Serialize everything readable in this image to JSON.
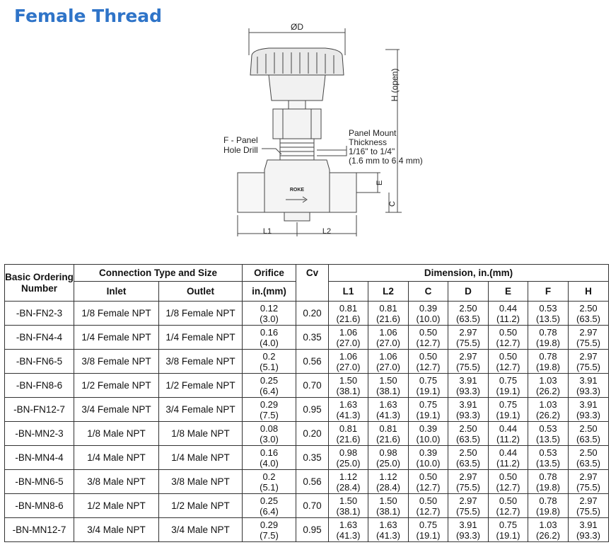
{
  "title": "Female Thread",
  "diagram": {
    "label_od": "ØD",
    "label_h": "H (open)",
    "label_f_line1": "F - Panel",
    "label_f_line2": "Hole Drill",
    "label_panel_1": "Panel Mount",
    "label_panel_2": "Thickness",
    "label_panel_3": "1/16\" to 1/4\"",
    "label_panel_4": "(1.6 mm to 6.4 mm)",
    "label_e": "E",
    "label_c": "C",
    "label_l1": "L1",
    "label_l2": "L2",
    "brand": "ROKE"
  },
  "table": {
    "headers": {
      "basic_ordering": "Basic Ordering Number",
      "connection": "Connection Type and Size",
      "inlet": "Inlet",
      "outlet": "Outlet",
      "orifice_1": "Orifice",
      "orifice_2": "in.(mm)",
      "cv": "Cv",
      "dimension": "Dimension, in.(mm)",
      "l1": "L1",
      "l2": "L2",
      "c": "C",
      "d": "D",
      "e": "E",
      "f": "F",
      "h": "H"
    },
    "rows": [
      {
        "num": "-BN-FN2-3",
        "inlet": "1/8 Female NPT",
        "outlet": "1/8 Female NPT",
        "orifice": "0.12",
        "orifice_mm": "(3.0)",
        "cv": "0.20",
        "l1": "0.81",
        "l1_mm": "(21.6)",
        "l2": "0.81",
        "l2_mm": "(21.6)",
        "c": "0.39",
        "c_mm": "(10.0)",
        "d": "2.50",
        "d_mm": "(63.5)",
        "e": "0.44",
        "e_mm": "(11.2)",
        "f": "0.53",
        "f_mm": "(13.5)",
        "h": "2.50",
        "h_mm": "(63.5)"
      },
      {
        "num": "-BN-FN4-4",
        "inlet": "1/4 Female NPT",
        "outlet": "1/4 Female NPT",
        "orifice": "0.16",
        "orifice_mm": "(4.0)",
        "cv": "0.35",
        "l1": "1.06",
        "l1_mm": "(27.0)",
        "l2": "1.06",
        "l2_mm": "(27.0)",
        "c": "0.50",
        "c_mm": "(12.7)",
        "d": "2.97",
        "d_mm": "(75.5)",
        "e": "0.50",
        "e_mm": "(12.7)",
        "f": "0.78",
        "f_mm": "(19.8)",
        "h": "2.97",
        "h_mm": "(75.5)"
      },
      {
        "num": "-BN-FN6-5",
        "inlet": "3/8 Female NPT",
        "outlet": "3/8 Female NPT",
        "orifice": "0.2",
        "orifice_mm": "(5.1)",
        "cv": "0.56",
        "l1": "1.06",
        "l1_mm": "(27.0)",
        "l2": "1.06",
        "l2_mm": "(27.0)",
        "c": "0.50",
        "c_mm": "(12.7)",
        "d": "2.97",
        "d_mm": "(75.5)",
        "e": "0.50",
        "e_mm": "(12.7)",
        "f": "0.78",
        "f_mm": "(19.8)",
        "h": "2.97",
        "h_mm": "(75.5)"
      },
      {
        "num": "-BN-FN8-6",
        "inlet": "1/2 Female NPT",
        "outlet": "1/2 Female NPT",
        "orifice": "0.25",
        "orifice_mm": "(6.4)",
        "cv": "0.70",
        "l1": "1.50",
        "l1_mm": "(38.1)",
        "l2": "1.50",
        "l2_mm": "(38.1)",
        "c": "0.75",
        "c_mm": "(19.1)",
        "d": "3.91",
        "d_mm": "(93.3)",
        "e": "0.75",
        "e_mm": "(19.1)",
        "f": "1.03",
        "f_mm": "(26.2)",
        "h": "3.91",
        "h_mm": "(93.3)"
      },
      {
        "num": "-BN-FN12-7",
        "inlet": "3/4 Female NPT",
        "outlet": "3/4 Female NPT",
        "orifice": "0.29",
        "orifice_mm": "(7.5)",
        "cv": "0.95",
        "l1": "1.63",
        "l1_mm": "(41.3)",
        "l2": "1.63",
        "l2_mm": "(41.3)",
        "c": "0.75",
        "c_mm": "(19.1)",
        "d": "3.91",
        "d_mm": "(93.3)",
        "e": "0.75",
        "e_mm": "(19.1)",
        "f": "1.03",
        "f_mm": "(26.2)",
        "h": "3.91",
        "h_mm": "(93.3)"
      },
      {
        "num": "-BN-MN2-3",
        "inlet": "1/8 Male NPT",
        "outlet": "1/8 Male NPT",
        "orifice": "0.08",
        "orifice_mm": "(3.0)",
        "cv": "0.20",
        "l1": "0.81",
        "l1_mm": "(21.6)",
        "l2": "0.81",
        "l2_mm": "(21.6)",
        "c": "0.39",
        "c_mm": "(10.0)",
        "d": "2.50",
        "d_mm": "(63.5)",
        "e": "0.44",
        "e_mm": "(11.2)",
        "f": "0.53",
        "f_mm": "(13.5)",
        "h": "2.50",
        "h_mm": "(63.5)"
      },
      {
        "num": "-BN-MN4-4",
        "inlet": "1/4 Male NPT",
        "outlet": "1/4 Male NPT",
        "orifice": "0.16",
        "orifice_mm": "(4.0)",
        "cv": "0.35",
        "l1": "0.98",
        "l1_mm": "(25.0)",
        "l2": "0.98",
        "l2_mm": "(25.0)",
        "c": "0.39",
        "c_mm": "(10.0)",
        "d": "2.50",
        "d_mm": "(63.5)",
        "e": "0.44",
        "e_mm": "(11.2)",
        "f": "0.53",
        "f_mm": "(13.5)",
        "h": "2.50",
        "h_mm": "(63.5)"
      },
      {
        "num": "-BN-MN6-5",
        "inlet": "3/8 Male NPT",
        "outlet": "3/8 Male NPT",
        "orifice": "0.2",
        "orifice_mm": "(5.1)",
        "cv": "0.56",
        "l1": "1.12",
        "l1_mm": "(28.4)",
        "l2": "1.12",
        "l2_mm": "(28.4)",
        "c": "0.50",
        "c_mm": "(12.7)",
        "d": "2.97",
        "d_mm": "(75.5)",
        "e": "0.50",
        "e_mm": "(12.7)",
        "f": "0.78",
        "f_mm": "(19.8)",
        "h": "2.97",
        "h_mm": "(75.5)"
      },
      {
        "num": "-BN-MN8-6",
        "inlet": "1/2 Male NPT",
        "outlet": "1/2 Male NPT",
        "orifice": "0.25",
        "orifice_mm": "(6.4)",
        "cv": "0.70",
        "l1": "1.50",
        "l1_mm": "(38.1)",
        "l2": "1.50",
        "l2_mm": "(38.1)",
        "c": "0.50",
        "c_mm": "(12.7)",
        "d": "2.97",
        "d_mm": "(75.5)",
        "e": "0.50",
        "e_mm": "(12.7)",
        "f": "0.78",
        "f_mm": "(19.8)",
        "h": "2.97",
        "h_mm": "(75.5)"
      },
      {
        "num": "-BN-MN12-7",
        "inlet": "3/4 Male NPT",
        "outlet": "3/4 Male NPT",
        "orifice": "0.29",
        "orifice_mm": "(7.5)",
        "cv": "0.95",
        "l1": "1.63",
        "l1_mm": "(41.3)",
        "l2": "1.63",
        "l2_mm": "(41.3)",
        "c": "0.75",
        "c_mm": "(19.1)",
        "d": "3.91",
        "d_mm": "(93.3)",
        "e": "0.75",
        "e_mm": "(19.1)",
        "f": "1.03",
        "f_mm": "(26.2)",
        "h": "3.91",
        "h_mm": "(93.3)"
      }
    ]
  }
}
